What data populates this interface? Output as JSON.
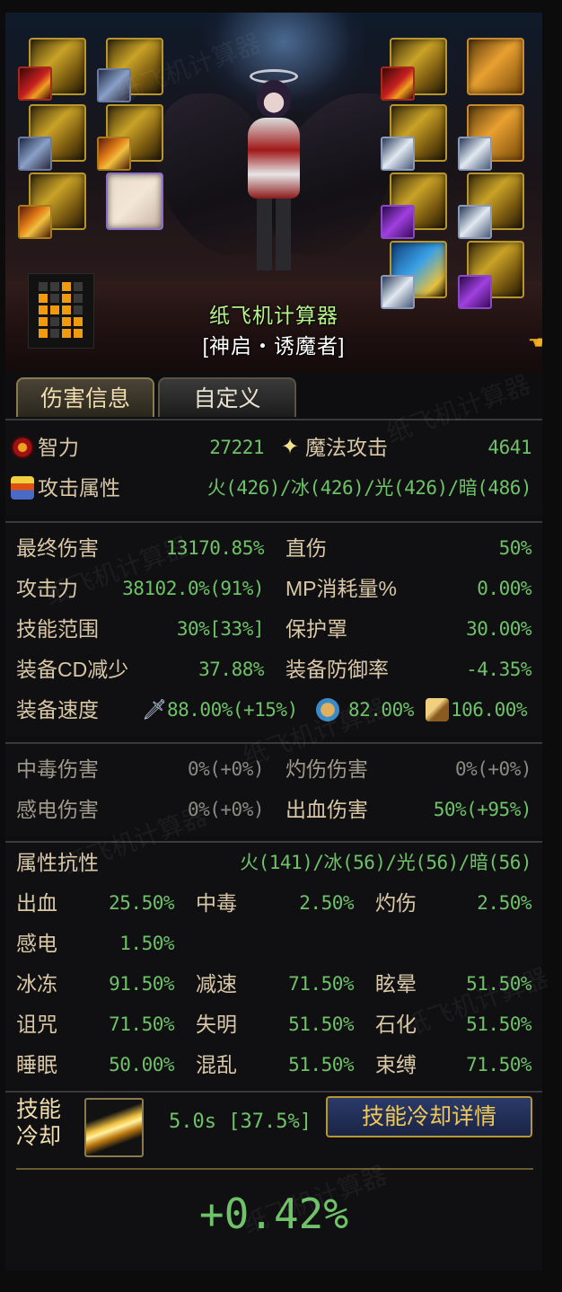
{
  "character": {
    "name": "纸飞机计算器",
    "class": "[神启・诱魔者]"
  },
  "title_grid": [
    0,
    0,
    1,
    0,
    1,
    0,
    1,
    0,
    1,
    1,
    1,
    0,
    1,
    0,
    1,
    1,
    1,
    0,
    1,
    1
  ],
  "tabs": [
    {
      "label": "伤害信息",
      "active": true
    },
    {
      "label": "自定义",
      "active": false
    }
  ],
  "primary": {
    "int_label": "智力",
    "int_value": "27221",
    "matk_label": "魔法攻击",
    "matk_value": "4641",
    "elem_label": "攻击属性",
    "elem_value": "火(426)/冰(426)/光(426)/暗(486)"
  },
  "damage": {
    "final_label": "最终伤害",
    "final_value": "13170.85%",
    "direct_label": "直伤",
    "direct_value": "50%",
    "atk_label": "攻击力",
    "atk_value": "38102.0%(91%)",
    "mp_label": "MP消耗量%",
    "mp_value": "0.00%",
    "range_label": "技能范围",
    "range_value": "30%[33%]",
    "shield_label": "保护罩",
    "shield_value": "30.00%",
    "cdr_label": "装备CD减少",
    "cdr_value": "37.88%",
    "def_label": "装备防御率",
    "def_value": "-4.35%",
    "speed_label": "装备速度",
    "speed_atk": "88.00%(+15%)",
    "speed_cast": "82.00%",
    "speed_move": "106.00%"
  },
  "status_dmg": {
    "poison_label": "中毒伤害",
    "poison_value": "0%(+0%)",
    "burn_label": "灼伤伤害",
    "burn_value": "0%(+0%)",
    "shock_label": "感电伤害",
    "shock_value": "0%(+0%)",
    "bleed_label": "出血伤害",
    "bleed_value": "50%(+95%)"
  },
  "resist": {
    "elem_label": "属性抗性",
    "elem_value": "火(141)/冰(56)/光(56)/暗(56)",
    "rows": [
      [
        {
          "l": "出血",
          "v": "25.50%"
        },
        {
          "l": "中毒",
          "v": "2.50%"
        },
        {
          "l": "灼伤",
          "v": "2.50%"
        }
      ],
      [
        {
          "l": "感电",
          "v": "1.50%"
        }
      ],
      [
        {
          "l": "冰冻",
          "v": "91.50%"
        },
        {
          "l": "减速",
          "v": "71.50%"
        },
        {
          "l": "眩晕",
          "v": "51.50%"
        }
      ],
      [
        {
          "l": "诅咒",
          "v": "71.50%"
        },
        {
          "l": "失明",
          "v": "51.50%"
        },
        {
          "l": "石化",
          "v": "51.50%"
        }
      ],
      [
        {
          "l": "睡眠",
          "v": "50.00%"
        },
        {
          "l": "混乱",
          "v": "51.50%"
        },
        {
          "l": "束缚",
          "v": "71.50%"
        }
      ]
    ]
  },
  "cooldown": {
    "label_line1": "技能",
    "label_line2": "冷却",
    "value": "5.0s [37.5%]",
    "button": "技能冷却详情"
  },
  "result": "+0.42%",
  "watermark": "纸飞机计算器",
  "colors": {
    "value_green": "#6ec268",
    "label_tan": "#d9c7a6",
    "name_green": "#b7f28a",
    "gold": "#f0c858"
  }
}
